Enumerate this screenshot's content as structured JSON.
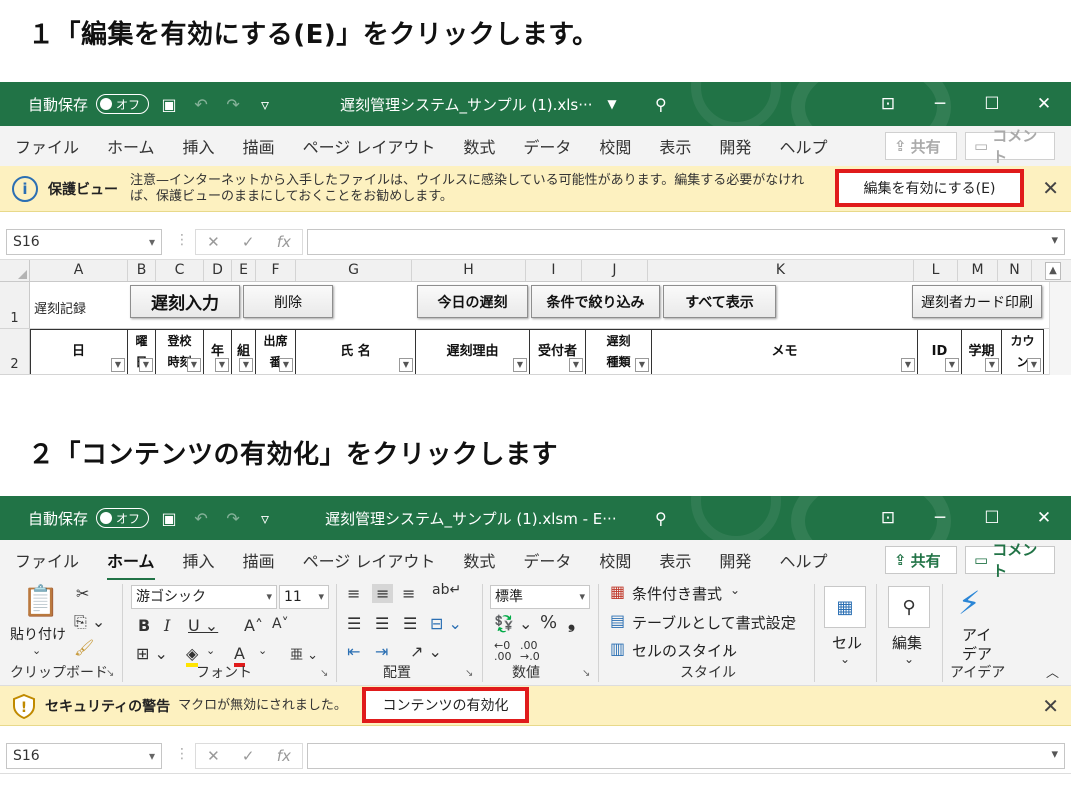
{
  "step1": {
    "title": "１「編集を有効にする(E)」をクリックします。"
  },
  "step2": {
    "title": "２「コンテンツの有効化」をクリックします"
  },
  "titlebar": {
    "autosave_label": "自動保存",
    "autosave_state": "オフ",
    "filename_1": "遅刻管理システム_サンプル (1).xls···",
    "filename_2": "遅刻管理システム_サンプル (1).xlsm  -  E···"
  },
  "tabs": [
    "ファイル",
    "ホーム",
    "挿入",
    "描画",
    "ページ レイアウト",
    "数式",
    "データ",
    "校閲",
    "表示",
    "開発",
    "ヘルプ"
  ],
  "share_label": "共有",
  "comment_label": "コメント",
  "protected_view": {
    "title": "保護ビュー",
    "message": "注意—インターネットから入手したファイルは、ウイルスに感染している可能性があります。編集する必要がなければ、保護ビューのままにしておくことをお勧めします。",
    "button": "編集を有効にする(E)"
  },
  "security_warning": {
    "title": "セキュリティの警告",
    "message": "マクロが無効にされました。",
    "button": "コンテンツの有効化"
  },
  "formula_bar": {
    "name_box": "S16"
  },
  "columns": [
    "A",
    "B",
    "C",
    "D",
    "E",
    "F",
    "G",
    "H",
    "I",
    "J",
    "K",
    "L",
    "M",
    "N"
  ],
  "rows": {
    "row1_label": "1",
    "row2_label": "2",
    "a1": "遅刻記録",
    "buttons": {
      "late_input": "遅刻入力",
      "delete": "削除",
      "today_late": "今日の遅刻",
      "filter": "条件で絞り込み",
      "show_all": "すべて表示",
      "print_card": "遅刻者カード印刷"
    },
    "headers": {
      "day": "日",
      "weekday": "曜\n日",
      "arrival": "登校\n時刻",
      "year": "年",
      "class": "組",
      "seat": "出席\n番",
      "name": "氏 名",
      "reason": "遅刻理由",
      "receiver": "受付者",
      "type": "遅刻\n種類",
      "memo": "メモ",
      "id": "ID",
      "term": "学期",
      "count": "カウ\nン"
    }
  },
  "ribbon": {
    "paste": "貼り付け",
    "clipboard": "クリップボード",
    "font_name": "游ゴシック",
    "font_size": "11",
    "font": "フォント",
    "alignment": "配置",
    "number_format": "標準",
    "number": "数値",
    "conditional": "条件付き書式",
    "table_format": "テーブルとして書式設定",
    "cell_style": "セルのスタイル",
    "style": "スタイル",
    "cells": "セル",
    "editing": "編集",
    "ideas": "アイ\nデア",
    "ideas_group": "アイデア"
  }
}
